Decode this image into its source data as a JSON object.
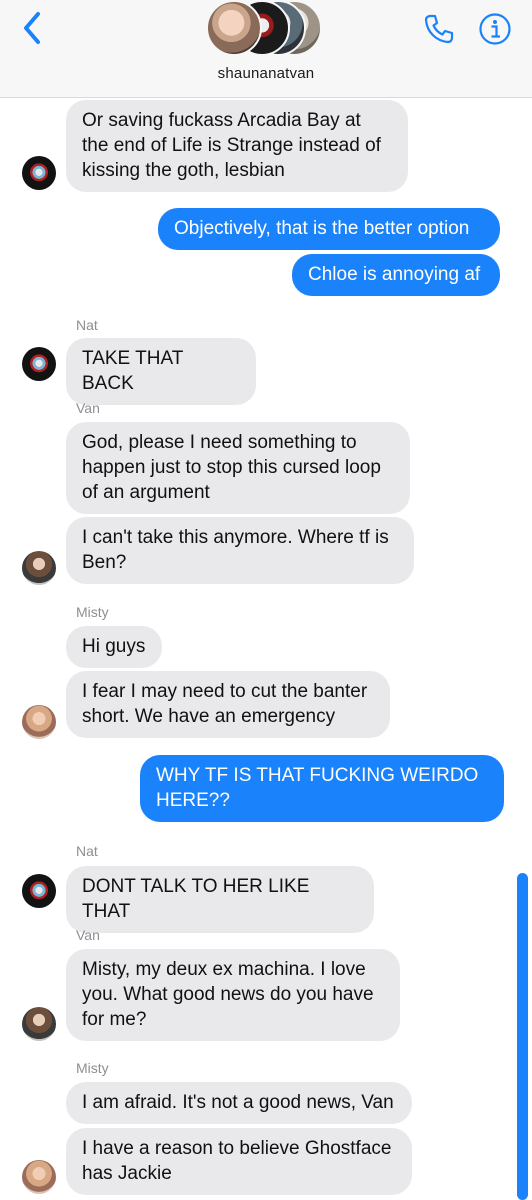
{
  "header": {
    "group_name": "shaunanatvan",
    "back_icon": "chevron-left-icon",
    "phone_icon": "phone-icon",
    "info_icon": "info-icon",
    "accent_color": "#1a82fb"
  },
  "messages": [
    {
      "direction": "incoming",
      "sender": "",
      "text": "Or saving fuckass Arcadia Bay at\nthe end of Life is Strange instead of\nkissing the goth, lesbian"
    },
    {
      "direction": "outgoing",
      "text": "Objectively, that is the better option"
    },
    {
      "direction": "outgoing",
      "text": "Chloe is annoying af"
    },
    {
      "direction": "incoming",
      "sender": "Nat",
      "text": "TAKE THAT BACK"
    },
    {
      "direction": "incoming",
      "sender": "Van",
      "text": "God, please I need something to\nhappen just to stop this cursed loop\nof an argument"
    },
    {
      "direction": "incoming",
      "sender": "",
      "text": "I can't take this anymore. Where tf is\nBen?"
    },
    {
      "direction": "incoming",
      "sender": "Misty",
      "text": "Hi guys"
    },
    {
      "direction": "incoming",
      "sender": "",
      "text": "I fear I may need to cut the banter\nshort. We have an emergency"
    },
    {
      "direction": "outgoing",
      "text": "WHY TF IS THAT FUCKING WEIRDO\nHERE??"
    },
    {
      "direction": "incoming",
      "sender": "Nat",
      "text": "DONT TALK TO HER LIKE THAT"
    },
    {
      "direction": "incoming",
      "sender": "Van",
      "text": "Misty, my deux ex machina. I love\nyou. What good news do you have\nfor me?"
    },
    {
      "direction": "incoming",
      "sender": "Misty",
      "text": "I am afraid. It's not a good news, Van"
    },
    {
      "direction": "incoming",
      "sender": "",
      "text": "I have a reason to believe Ghostface\nhas Jackie"
    }
  ],
  "colors": {
    "incoming_bubble": "#e9e9eb",
    "outgoing_bubble": "#1a82fb",
    "sender_label": "#8e8e93"
  }
}
